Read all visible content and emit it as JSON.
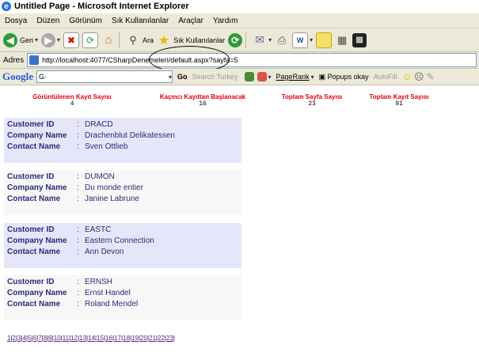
{
  "window": {
    "title": "Untitled Page - Microsoft Internet Explorer"
  },
  "menu": [
    "Dosya",
    "Düzen",
    "Görünüm",
    "Sık Kullanılanlar",
    "Araçlar",
    "Yardım"
  ],
  "toolbar": {
    "back_label": "Geri",
    "search_label": "Ara",
    "favorites_label": "Sık Kullanılanlar"
  },
  "address": {
    "label": "Adres",
    "url": "http://localhost:4077/CSharpDenemeleri/default.aspx?sayfa=5"
  },
  "google": {
    "logo": "Google",
    "search_prefix": "G·",
    "go_label": "Go",
    "search_turkey": "Search Turkey",
    "pagerank": "PageRank",
    "popups": "Popups okay",
    "autofill": "AutoFill"
  },
  "stats": [
    {
      "label": "Görüntülenen Kayıt Sayısı",
      "value": "4"
    },
    {
      "label": "Kaçıncı Kayıttan Başlanacak",
      "value": "16"
    },
    {
      "label": "Toplam Sayfa Sayısı",
      "value": "23"
    },
    {
      "label": "Toplam Kayıt Sayısı",
      "value": "91"
    }
  ],
  "field_labels": {
    "customer_id": "Customer ID",
    "company_name": "Company Name",
    "contact_name": "Contact Name",
    "colon": ":"
  },
  "records": [
    {
      "customer_id": "DRACD",
      "company_name": "Drachenblut Delikatessen",
      "contact_name": "Sven Ottlieb"
    },
    {
      "customer_id": "DUMON",
      "company_name": "Du monde entier",
      "contact_name": "Janine Labrune"
    },
    {
      "customer_id": "EASTC",
      "company_name": "Eastern Connection",
      "contact_name": "Ann Devon"
    },
    {
      "customer_id": "ERNSH",
      "company_name": "Ernst Handel",
      "contact_name": "Roland Mendel"
    }
  ],
  "pager": [
    "1",
    "2",
    "3",
    "4",
    "5",
    "6",
    "7",
    "8",
    "9",
    "10",
    "11",
    "12",
    "13",
    "14",
    "15",
    "16",
    "17",
    "18",
    "19",
    "20",
    "21",
    "22",
    "23"
  ]
}
